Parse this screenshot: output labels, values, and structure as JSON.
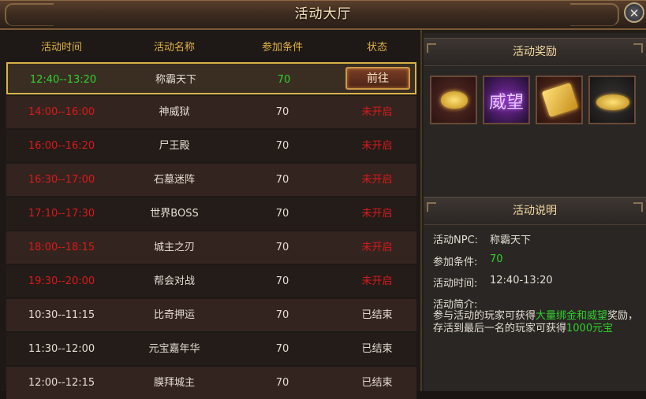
{
  "window": {
    "title": "活动大厅",
    "close_glyph": "✕"
  },
  "table": {
    "headers": {
      "time": "活动时间",
      "name": "活动名称",
      "requirement": "参加条件",
      "status": "状态"
    },
    "selected": {
      "time": "12:40--13:20",
      "name": "称霸天下",
      "requirement": "70",
      "button": "前往"
    },
    "rows": [
      {
        "time": "14:00--16:00",
        "name": "神威狱",
        "requirement": "70",
        "status": "未开启"
      },
      {
        "time": "16:00--16:20",
        "name": "尸王殿",
        "requirement": "70",
        "status": "未开启"
      },
      {
        "time": "16:30--17:00",
        "name": "石墓迷阵",
        "requirement": "70",
        "status": "未开启"
      },
      {
        "time": "17:10--17:30",
        "name": "世界BOSS",
        "requirement": "70",
        "status": "未开启"
      },
      {
        "time": "18:00--18:15",
        "name": "城主之刃",
        "requirement": "70",
        "status": "未开启"
      },
      {
        "time": "19:30--20:00",
        "name": "帮会对战",
        "requirement": "70",
        "status": "未开启"
      },
      {
        "time": "10:30--11:15",
        "name": "比奇押运",
        "requirement": "70",
        "status": "已结束"
      },
      {
        "time": "11:30--12:00",
        "name": "元宝嘉年华",
        "requirement": "70",
        "status": "已结束"
      },
      {
        "time": "12:00--12:15",
        "name": "膜拜城主",
        "requirement": "70",
        "status": "已结束"
      }
    ]
  },
  "rewards": {
    "title": "活动奖励",
    "items": [
      {
        "icon": "gold-ingot-icon"
      },
      {
        "icon": "prestige-icon",
        "label": "威望"
      },
      {
        "icon": "gold-ticket-icon"
      },
      {
        "icon": "gold-coins-icon"
      }
    ]
  },
  "description": {
    "title": "活动说明",
    "npc_label": "活动NPC:",
    "npc_value": "称霸天下",
    "req_label": "参加条件:",
    "req_value": "70",
    "time_label": "活动时间:",
    "time_value": "12:40-13:20",
    "intro_label": "活动简介:",
    "intro_part1": "参与活动的玩家可获得",
    "intro_hl1": "大量绑金和威望",
    "intro_part2": "奖励，存活到最后一名的玩家可获得",
    "intro_hl2": "1000元宝"
  },
  "colors": {
    "time_active": "#2fd12f",
    "not_started": "#d91a1a",
    "header": "#e0b24a"
  }
}
